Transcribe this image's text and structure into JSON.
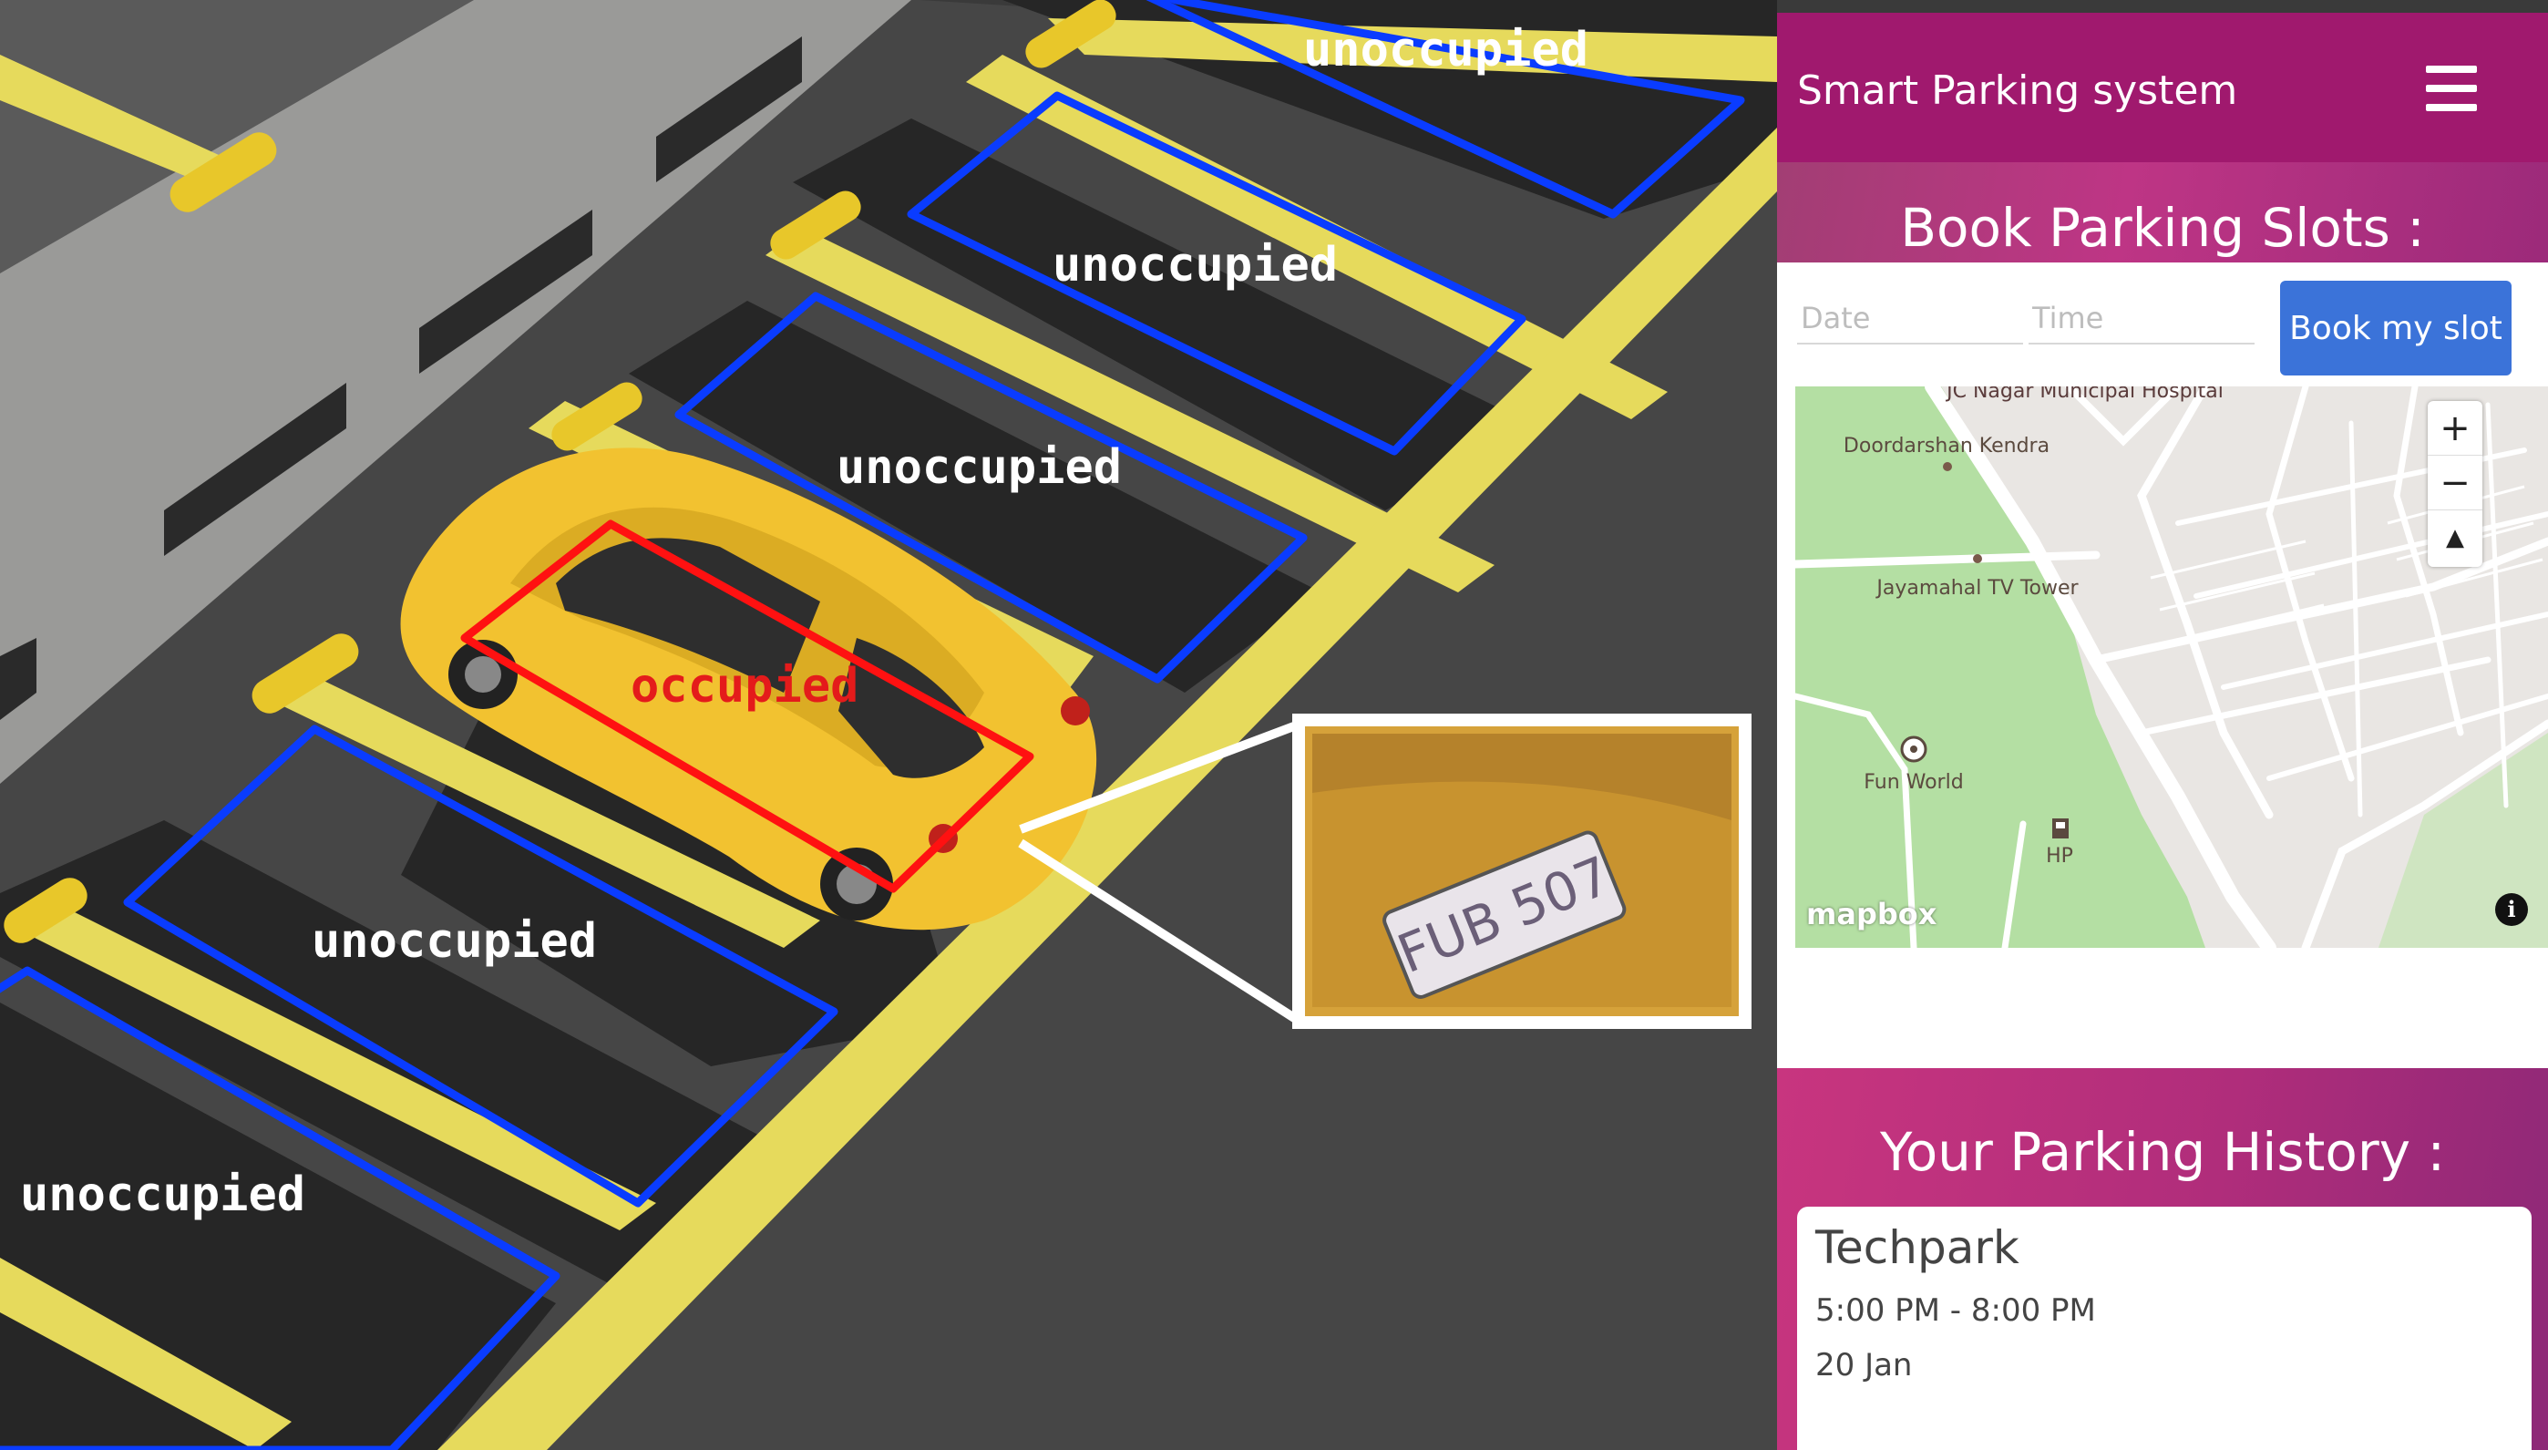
{
  "camera": {
    "slots": [
      {
        "label": "unoccupied",
        "status": "free"
      },
      {
        "label": "unoccupied",
        "status": "free"
      },
      {
        "label": "unoccupied",
        "status": "free"
      },
      {
        "label": "occupied",
        "status": "taken"
      },
      {
        "label": "unoccupied",
        "status": "free"
      },
      {
        "label": "unoccupied",
        "status": "free"
      }
    ],
    "plate_text": "FUB 507",
    "colors": {
      "free_box": "#0a3cff",
      "taken_box": "#ff1111",
      "car": "#f2c230",
      "paint_line": "#e6da5c"
    }
  },
  "app": {
    "title": "Smart Parking system",
    "menu_icon": "hamburger-menu-icon",
    "book_heading": "Book Parking Slots :",
    "date_placeholder": "Date",
    "time_placeholder": "Time",
    "book_button": "Book my slot",
    "map": {
      "labels": {
        "hospital": "JC Nagar Municipal Hospital",
        "doordarshan": "Doordarshan Kendra",
        "tv_tower": "Jayamahal TV Tower",
        "fun_world": "Fun World",
        "hp": "HP"
      },
      "zoom_in": "+",
      "zoom_out": "−",
      "compass": "▲",
      "attribution_logo": "mapbox",
      "info": "i"
    },
    "history_heading": "Your Parking History :",
    "history": [
      {
        "place": "Techpark",
        "time": "5:00 PM - 8:00 PM",
        "date": "20 Jan"
      }
    ],
    "colors": {
      "appbar": "#a0196e",
      "button": "#3b73d9",
      "band": "#be3585"
    }
  }
}
